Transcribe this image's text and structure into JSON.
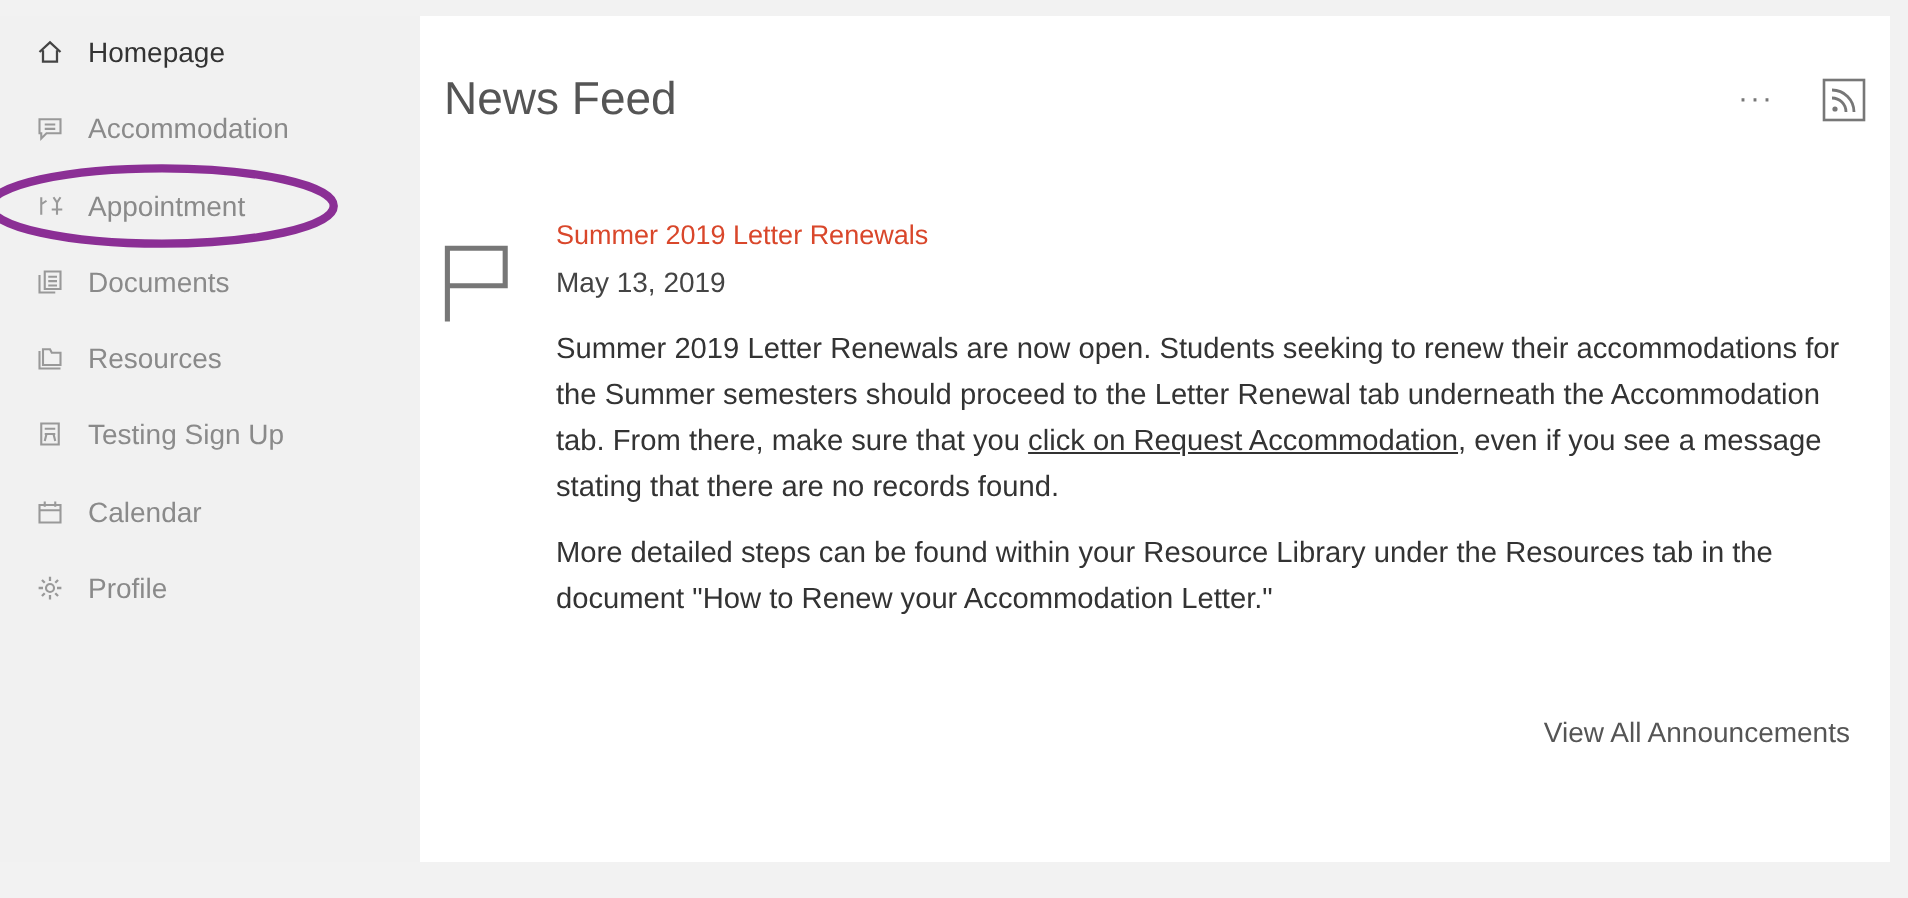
{
  "sidebar": {
    "items": [
      {
        "label": "Homepage",
        "selected": true,
        "circled": false
      },
      {
        "label": "Accommodation",
        "selected": false,
        "circled": false
      },
      {
        "label": "Appointment",
        "selected": false,
        "circled": true
      },
      {
        "label": "Documents",
        "selected": false,
        "circled": false
      },
      {
        "label": "Resources",
        "selected": false,
        "circled": false
      },
      {
        "label": "Testing Sign Up",
        "selected": false,
        "circled": false
      },
      {
        "label": "Calendar",
        "selected": false,
        "circled": false
      },
      {
        "label": "Profile",
        "selected": false,
        "circled": false
      }
    ]
  },
  "news_feed": {
    "title": "News Feed",
    "menu": "···",
    "post": {
      "title": "Summer 2019 Letter Renewals",
      "date": "May 13, 2019",
      "paragraph_1": {
        "before": "Summer 2019 Letter Renewals are now open. Students seeking to renew their accommodations for the Summer semesters should proceed to the Letter Renewal tab underneath the Accommodation tab. From there, make sure that you ",
        "link": "click on Request Accommodation",
        "after": ", even if you see a message stating that there are no records found."
      },
      "paragraph_2": "More detailed steps can be found within your Resource Library under the Resources tab in the document \"How to Renew your Accommodation Letter.\""
    },
    "view_all": "View All Announcements"
  }
}
